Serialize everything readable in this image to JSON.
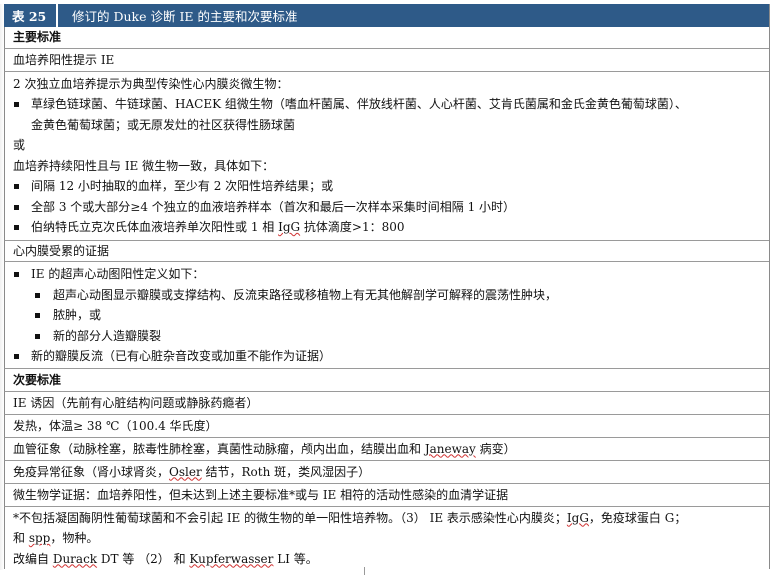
{
  "title": {
    "label": "表 25",
    "text": "修订的 Duke 诊断 IE 的主要和次要标准"
  },
  "major": {
    "heading": "主要标准",
    "blood_culture_head": "血培养阳性提示 IE",
    "bc_intro": "2 次独立血培养提示为典型传染性心内膜炎微生物：",
    "bc_bullet1a": "草绿色链球菌、牛链球菌、HACEK 组微生物（嗜血杆菌属、伴放线杆菌、人心杆菌、艾肯氏菌属和金氏金黄色葡萄球菌）、",
    "bc_bullet1b": "金黄色葡萄球菌；或无原发灶的社区获得性肠球菌",
    "bc_or": "或",
    "bc_persist": "血培养持续阳性且与 IE 微生物一致，具体如下：",
    "bc_bullet2": "间隔 12 小时抽取的血样，至少有 2 次阳性培养结果；或",
    "bc_bullet3": "全部 3 个或大部分≥4 个独立的血液培养样本（首次和最后一次样本采集时间相隔 1 小时）",
    "bc_bullet4_pre": "伯纳特氏立克次氏体血液培养单次阳性或 1 相 ",
    "bc_bullet4_igg": "IgG",
    "bc_bullet4_post": " 抗体滴度>1：800",
    "endo_head": "心内膜受累的证据",
    "endo_bullet1": "IE 的超声心动图阳性定义如下：",
    "endo_sub1": "超声心动图显示瓣膜或支撑结构、反流束路径或移植物上有无其他解剖学可解释的震荡性肿块，",
    "endo_sub2": "脓肿，或",
    "endo_sub3": "新的部分人造瓣膜裂",
    "endo_bullet2": "新的瓣膜反流（已有心脏杂音改变或加重不能作为证据）"
  },
  "minor": {
    "heading": "次要标准",
    "item1": "IE 诱因（先前有心脏结构问题或静脉药瘾者）",
    "item2": "发热，体温≥ 38 ℃（100.4  华氏度）",
    "item3_pre": "血管征象（动脉栓塞，脓毒性肺栓塞，真菌性动脉瘤，颅内出血，结膜出血和 ",
    "item3_w": "Janeway",
    "item3_post": " 病变）",
    "item4_pre": "免疫异常征象（肾小球肾炎，",
    "item4_w": "Osler",
    "item4_post": " 结节，Roth 斑，类风湿因子）",
    "item5": "微生物学证据：血培养阳性，但未达到上述主要标准*或与 IE 相符的活动性感染的血清学证据"
  },
  "footnote": {
    "line1_pre": "*不包括凝固酶阴性葡萄球菌和不会引起  IE  的微生物的单一阳性培养物。（3）  IE  表示感染性心内膜炎；",
    "line1_igg": "IgG",
    "line1_post": "，免疫球蛋白 G；",
    "line2_pre": "和  ",
    "line2_spp": "spp",
    "line2_post": "，物种。",
    "line3_pre": "改编自  ",
    "line3_durack": "Durack",
    "line3_mid": " DT  等  （2）  和  ",
    "line3_kupf": "Kupferwasser",
    "line3_post": " LI 等。"
  }
}
